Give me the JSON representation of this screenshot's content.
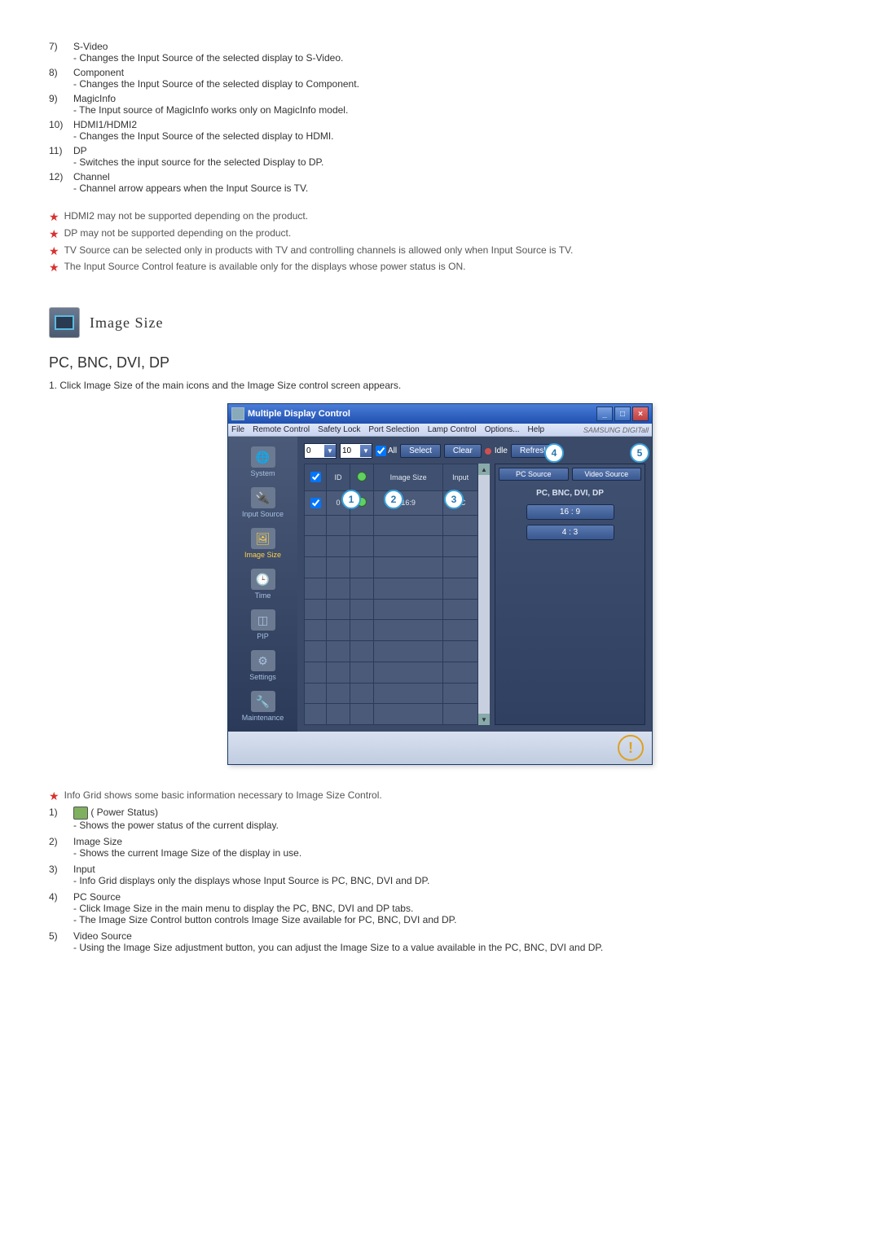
{
  "top_list": [
    {
      "num": "7)",
      "title": "S-Video",
      "desc": [
        "Changes the Input Source of the selected display to S-Video."
      ]
    },
    {
      "num": "8)",
      "title": "Component",
      "desc": [
        "Changes the Input Source of the selected display to Component."
      ]
    },
    {
      "num": "9)",
      "title": "MagicInfo",
      "desc": [
        "The Input source of MagicInfo works only on MagicInfo model."
      ]
    },
    {
      "num": "10)",
      "title": "HDMI1/HDMI2",
      "desc": [
        "Changes the Input Source of the selected display to HDMI."
      ]
    },
    {
      "num": "11)",
      "title": "DP",
      "desc": [
        "Switches the input source for the selected Display to DP."
      ]
    },
    {
      "num": "12)",
      "title": "Channel",
      "desc": [
        "Channel arrow appears when the Input Source is TV."
      ]
    }
  ],
  "star_notes": [
    "HDMI2 may not be supported depending on the product.",
    "DP may not be supported depending on the product.",
    "TV Source can be selected only in products with TV and controlling channels is allowed only when Input Source is TV.",
    "The Input Source Control feature is available only for the displays whose power status is ON."
  ],
  "section_title": "Image Size",
  "subsection_title": "PC, BNC, DVI, DP",
  "instruction": "1. Click Image Size of the main icons and the Image Size control screen appears.",
  "app": {
    "title": "Multiple Display Control",
    "menus": [
      "File",
      "Remote Control",
      "Safety Lock",
      "Port Selection",
      "Lamp Control",
      "Options...",
      "Help"
    ],
    "brand": "SAMSUNG DIGITall",
    "dropdown1": "0",
    "dropdown2": "10",
    "all_label": "All",
    "btn_select": "Select",
    "btn_clear": "Clear",
    "idle_label": "Idle",
    "btn_refresh": "Refresh",
    "sidebar": [
      {
        "label": "System",
        "cls": "system"
      },
      {
        "label": "Input Source",
        "cls": "input"
      },
      {
        "label": "Image Size",
        "cls": "image",
        "active": true
      },
      {
        "label": "Time",
        "cls": "time"
      },
      {
        "label": "PIP",
        "cls": "pip"
      },
      {
        "label": "Settings",
        "cls": "settings"
      },
      {
        "label": "Maintenance",
        "cls": "maint"
      }
    ],
    "grid_headers": {
      "id": "ID",
      "size": "Image Size",
      "input": "Input"
    },
    "grid_row": {
      "id": "0",
      "size": "16:9",
      "input": "PC"
    },
    "tabs": {
      "pc": "PC Source",
      "video": "Video Source"
    },
    "panel_title": "PC, BNC, DVI, DP",
    "btn_169": "16 : 9",
    "btn_43": "4 : 3"
  },
  "star_info": "Info Grid shows some basic information necessary to Image Size Control.",
  "bottom_list": [
    {
      "num": "1)",
      "title": "( Power Status)",
      "icon": true,
      "desc": [
        "Shows the power status of the current display."
      ]
    },
    {
      "num": "2)",
      "title": "Image Size",
      "desc": [
        "Shows the current Image Size of the display in use."
      ]
    },
    {
      "num": "3)",
      "title": "Input",
      "desc": [
        "Info Grid displays only the displays whose Input Source is PC, BNC, DVI and DP."
      ]
    },
    {
      "num": "4)",
      "title": "PC Source",
      "desc": [
        "Click Image Size in the main menu to display the PC, BNC, DVI and DP tabs.",
        "The Image Size Control button controls Image Size available for PC, BNC, DVI and DP."
      ]
    },
    {
      "num": "5)",
      "title": "Video Source",
      "desc": [
        "Using the Image Size adjustment button, you can adjust the Image Size to a value available in the PC, BNC, DVI and DP."
      ]
    }
  ]
}
